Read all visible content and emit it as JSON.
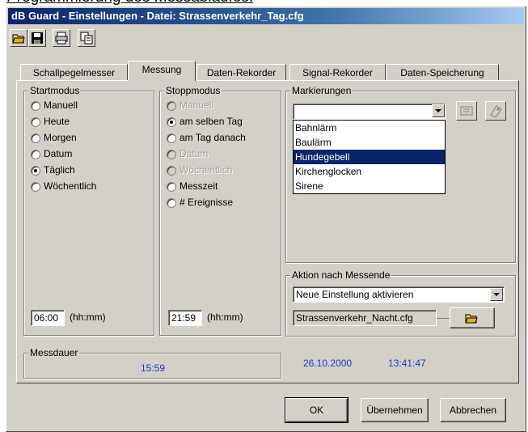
{
  "doc_heading": "Programmierung des Messablaufes:",
  "window": {
    "title": "dB Guard  -  Einstellungen  -  Datei: Strassenverkehr_Tag.cfg"
  },
  "toolbar": {
    "icons": [
      "open-folder-icon",
      "save-disk-icon",
      "print-icon",
      "copy-icon"
    ]
  },
  "tabs": [
    {
      "label": "Schallpegelmesser",
      "active": false
    },
    {
      "label": "Messung",
      "active": true
    },
    {
      "label": "Daten-Rekorder",
      "active": false
    },
    {
      "label": "Signal-Rekorder",
      "active": false
    },
    {
      "label": "Daten-Speicherung",
      "active": false
    }
  ],
  "startmodus": {
    "legend": "Startmodus",
    "options": [
      {
        "label": "Manuell",
        "checked": false,
        "enabled": true
      },
      {
        "label": "Heute",
        "checked": false,
        "enabled": true
      },
      {
        "label": "Morgen",
        "checked": false,
        "enabled": true
      },
      {
        "label": "Datum",
        "checked": false,
        "enabled": true
      },
      {
        "label": "Täglich",
        "checked": true,
        "enabled": true
      },
      {
        "label": "Wöchentlich",
        "checked": false,
        "enabled": true
      }
    ],
    "time_value": "06:00",
    "time_unit": "(hh:mm)"
  },
  "stoppmodus": {
    "legend": "Stoppmodus",
    "options": [
      {
        "label": "Manuell",
        "checked": false,
        "enabled": false
      },
      {
        "label": "am selben Tag",
        "checked": true,
        "enabled": true
      },
      {
        "label": "am Tag danach",
        "checked": false,
        "enabled": true
      },
      {
        "label": "Datum",
        "checked": false,
        "enabled": false
      },
      {
        "label": "Wöchentlich",
        "checked": false,
        "enabled": false
      },
      {
        "label": "Messzeit",
        "checked": false,
        "enabled": true
      },
      {
        "label": "# Ereignisse",
        "checked": false,
        "enabled": true
      }
    ],
    "time_value": "21:59",
    "time_unit": "(hh:mm)"
  },
  "markierungen": {
    "legend": "Markierungen",
    "combo_value": "",
    "items": [
      "Bahnlärm",
      "Baulärm",
      "Hundegebell",
      "Kirchenglocken",
      "Sirene"
    ],
    "selected": "Hundegebell"
  },
  "aktion": {
    "legend": "Aktion nach Messende",
    "select_value": "Neue Einstellung aktivieren",
    "file_value": "Strassenverkehr_Nacht.cfg"
  },
  "messdauer": {
    "legend": "Messdauer",
    "value": "15:59"
  },
  "status": {
    "date": "26.10.2000",
    "time": "13:41:47"
  },
  "buttons": {
    "ok": "OK",
    "apply": "Übernehmen",
    "cancel": "Abbrechen"
  },
  "colors": {
    "title_bar": "#0a246a",
    "selection": "#0a246a",
    "info_text": "#1a3ccc",
    "face": "#d4d0c8"
  }
}
